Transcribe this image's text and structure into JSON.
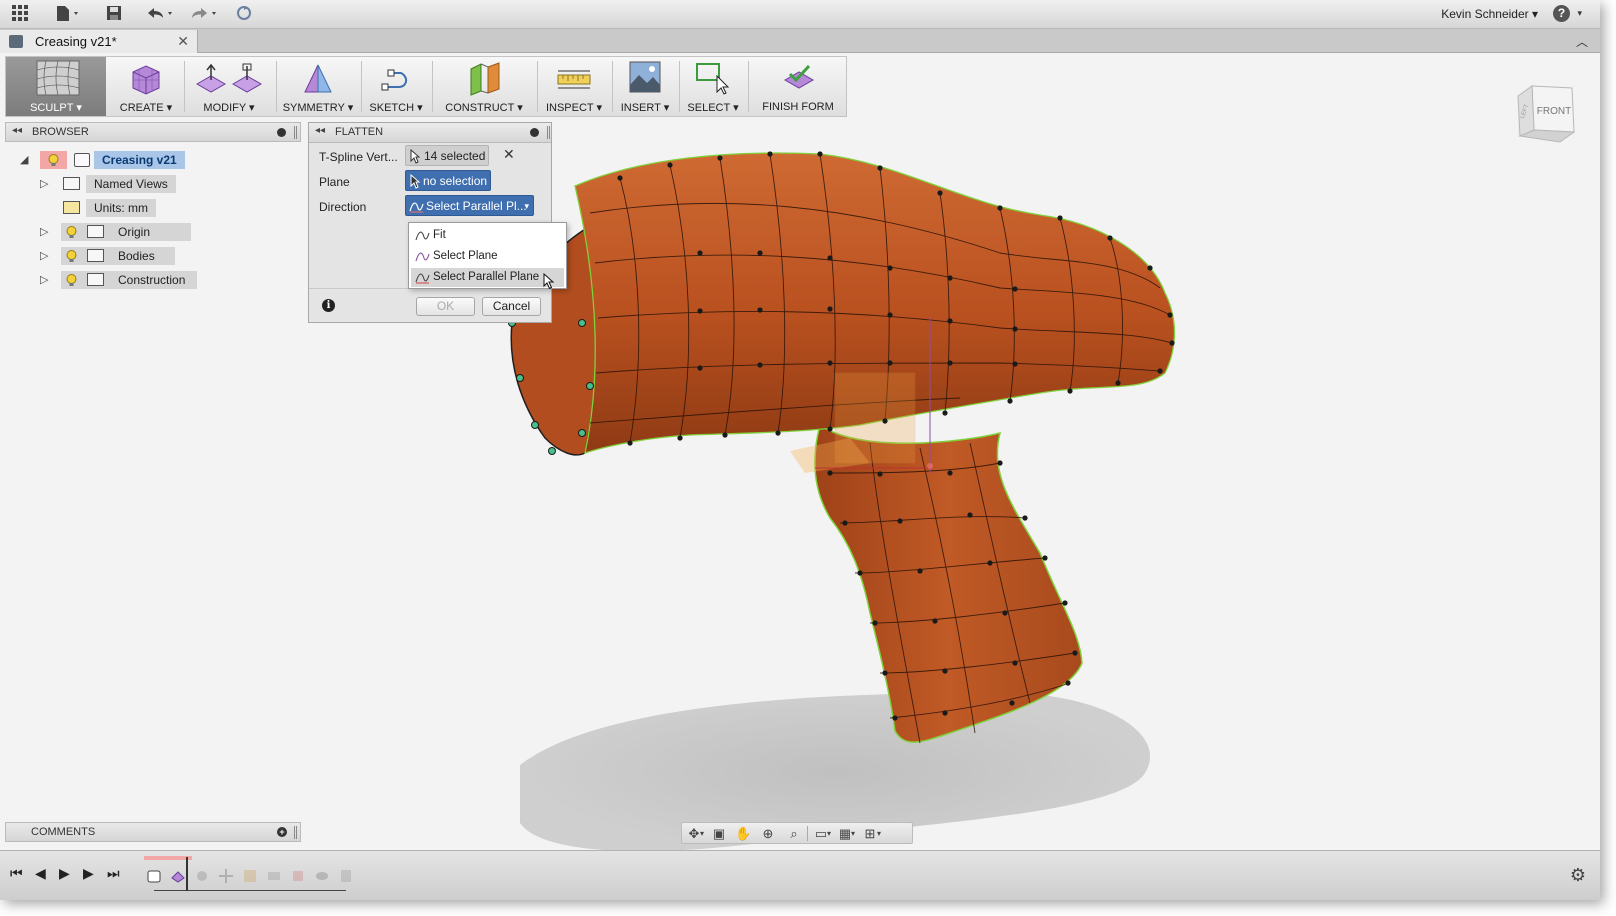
{
  "app": {
    "user_name": "Kevin Schneider",
    "document_tab": "Creasing v21*",
    "help_label": "?"
  },
  "toolbar": {
    "workspace_label": "SCULPT",
    "tools": [
      {
        "label": "CREATE"
      },
      {
        "label": "MODIFY"
      },
      {
        "label": "SYMMETRY"
      },
      {
        "label": "SKETCH"
      },
      {
        "label": "CONSTRUCT"
      },
      {
        "label": "INSPECT"
      },
      {
        "label": "INSERT"
      },
      {
        "label": "SELECT"
      },
      {
        "label": "FINISH FORM"
      }
    ],
    "caret": "▾"
  },
  "browser": {
    "title": "BROWSER",
    "root": "Creasing v21",
    "items": [
      {
        "label": "Named Views"
      },
      {
        "label": "Units: mm"
      },
      {
        "label": "Origin"
      },
      {
        "label": "Bodies"
      },
      {
        "label": "Construction"
      }
    ]
  },
  "flatten_dialog": {
    "title": "FLATTEN",
    "tspline_label": "T-Spline Vert...",
    "tspline_value": "14 selected",
    "plane_label": "Plane",
    "plane_value": "no selection",
    "direction_label": "Direction",
    "direction_value": "Select Parallel Pl...",
    "direction_options": [
      "Fit",
      "Select Plane",
      "Select Parallel Plane"
    ],
    "selected_option_index": 2,
    "ok_label": "OK",
    "cancel_label": "Cancel",
    "info_label": "i"
  },
  "viewcube": {
    "face_label": "FRONT",
    "side_label": "LEFT"
  },
  "comments": {
    "title": "COMMENTS"
  },
  "colors": {
    "body": "#b8501f",
    "edge_highlight": "#7fd13b",
    "selected_vertex": "#48c08b",
    "accent_blue": "#3f6fae"
  },
  "icons": {
    "apps": "grid-icon",
    "file": "file-icon",
    "save": "save-icon",
    "undo": "undo-icon",
    "redo": "redo-icon",
    "settings": "gear-icon"
  }
}
